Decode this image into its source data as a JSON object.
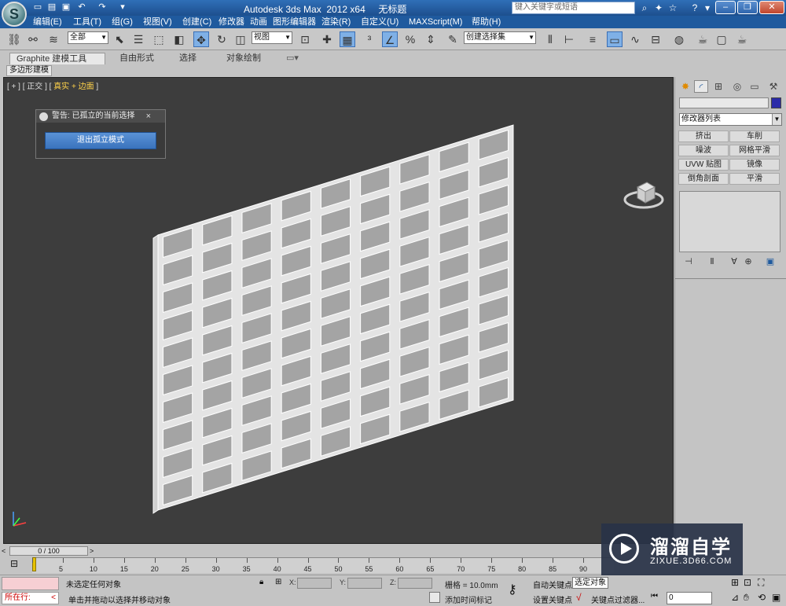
{
  "window": {
    "title": "Autodesk 3ds Max  2012 x64     无标题",
    "search_placeholder": "键入关键字或短语"
  },
  "menu": [
    "编辑(E)",
    "工具(T)",
    "组(G)",
    "视图(V)",
    "创建(C)",
    "修改器",
    "动画",
    "图形编辑器",
    "渲染(R)",
    "自定义(U)",
    "MAXScript(M)",
    "帮助(H)"
  ],
  "toolbar": {
    "selection_filter": "全部",
    "ref_coord": "视图",
    "named_selection": "创建选择集"
  },
  "ribbon": {
    "tabs": [
      "Graphite 建模工具",
      "自由形式",
      "选择",
      "对象绘制"
    ],
    "subtab": "多边形建模"
  },
  "viewport": {
    "label_prefix": "[ + ] [ 正交 ] [ ",
    "label_shading": "真实 + 边面",
    "label_suffix": " ]",
    "grid_rows": 10,
    "grid_cols": 9
  },
  "warning_dialog": {
    "title": "警告: 已孤立的当前选择",
    "close_glyph": "×",
    "button": "退出孤立模式"
  },
  "command_panel": {
    "modifier_list": "修改器列表",
    "modifier_buttons": [
      "挤出",
      "车削",
      "噪波",
      "网格平滑",
      "UVW 贴图",
      "镜像",
      "倒角剖面",
      "平滑"
    ]
  },
  "timeline": {
    "frame_display": "0 / 100",
    "ticks": [
      0,
      5,
      10,
      15,
      20,
      25,
      30,
      35,
      40,
      45,
      50,
      55,
      60,
      65,
      70,
      75,
      80,
      85,
      90
    ]
  },
  "status": {
    "script_prompt": "所在行:",
    "selection": "未选定任何对象",
    "hint": "单击并拖动以选择并移动对象",
    "x_label": "X:",
    "y_label": "Y:",
    "z_label": "Z:",
    "grid": "栅格 = 10.0mm",
    "add_time_tag": "添加时间标记",
    "auto_key": "自动关键点",
    "set_key": "设置关键点",
    "selected": "选定对象",
    "key_filter": "关键点过滤器...",
    "frame": "0"
  },
  "watermark": {
    "title": "溜溜自学",
    "url": "ZIXUE.3D66.COM"
  }
}
